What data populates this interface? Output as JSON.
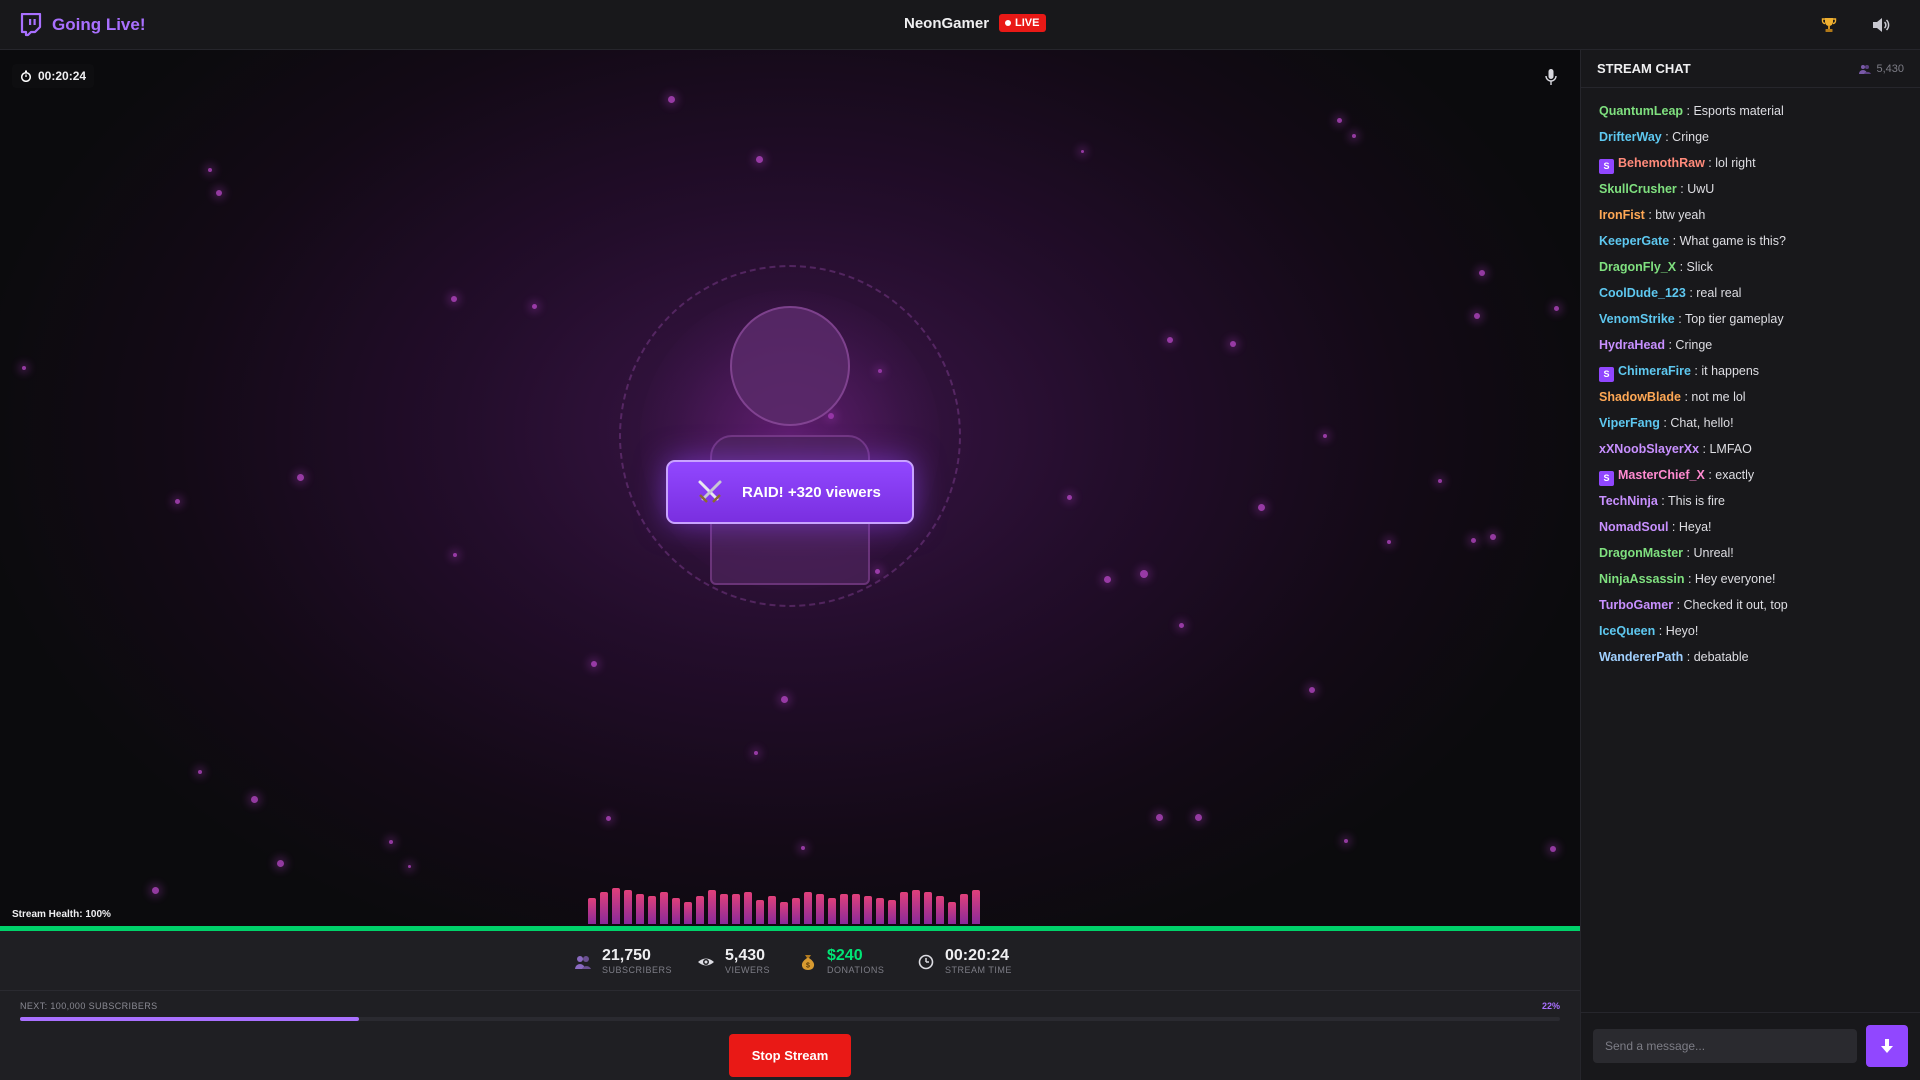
{
  "app": {
    "title": "Going Live!",
    "streamer": "NeonGamer",
    "live_label": "LIVE"
  },
  "colors": {
    "accent": "#9147ff",
    "live": "#e91916",
    "health": "#00d26a",
    "donation": "#00e676"
  },
  "stream": {
    "timer": "00:20:24",
    "raid_text": "RAID! +320 viewers",
    "health_label": "Stream Health: 100%",
    "health_percent": 100
  },
  "stats": {
    "subscribers": {
      "value": "21,750",
      "label": "SUBSCRIBERS"
    },
    "viewers": {
      "value": "5,430",
      "label": "VIEWERS"
    },
    "donations": {
      "value": "$240",
      "label": "DONATIONS"
    },
    "stream_time": {
      "value": "00:20:24",
      "label": "STREAM TIME"
    }
  },
  "goal": {
    "label": "NEXT: 100,000 SUBSCRIBERS",
    "percent_label": "22%",
    "percent": 22
  },
  "controls": {
    "stop_label": "Stop Stream"
  },
  "icons": {
    "top_right": [
      "trophy-icon",
      "speaker-icon"
    ],
    "stream": [
      "stopwatch-icon",
      "microphone-icon",
      "crossed-swords-icon"
    ],
    "stats": [
      "people-icon",
      "eye-icon",
      "money-bag-icon",
      "clock-icon"
    ]
  },
  "chat": {
    "title": "STREAM CHAT",
    "viewer_count": "5,430",
    "input_placeholder": "Send a message...",
    "messages": [
      {
        "user": "QuantumLeap",
        "color": "#7fe07f",
        "text": "Esports material",
        "sub": false
      },
      {
        "user": "DrifterWay",
        "color": "#5ec8f0",
        "text": "Cringe",
        "sub": false
      },
      {
        "user": "BehemothRaw",
        "color": "#ff8a7a",
        "text": "lol right",
        "sub": true
      },
      {
        "user": "SkullCrusher",
        "color": "#7fe07f",
        "text": "UwU",
        "sub": false
      },
      {
        "user": "IronFist",
        "color": "#ffa855",
        "text": "btw yeah",
        "sub": false
      },
      {
        "user": "KeeperGate",
        "color": "#5ec8f0",
        "text": "What game is this?",
        "sub": false
      },
      {
        "user": "DragonFly_X",
        "color": "#7fe07f",
        "text": "Slick",
        "sub": false
      },
      {
        "user": "CoolDude_123",
        "color": "#5ec8f0",
        "text": "real real",
        "sub": false
      },
      {
        "user": "VenomStrike",
        "color": "#5ec8f0",
        "text": "Top tier gameplay",
        "sub": false
      },
      {
        "user": "HydraHead",
        "color": "#c890ff",
        "text": "Cringe",
        "sub": false
      },
      {
        "user": "ChimeraFire",
        "color": "#5ec8f0",
        "text": "it happens",
        "sub": true
      },
      {
        "user": "ShadowBlade",
        "color": "#ffa855",
        "text": "not me lol",
        "sub": false
      },
      {
        "user": "ViperFang",
        "color": "#5ec8f0",
        "text": "Chat, hello!",
        "sub": false
      },
      {
        "user": "xXNoobSlayerXx",
        "color": "#c890ff",
        "text": "LMFAO",
        "sub": false
      },
      {
        "user": "MasterChief_X",
        "color": "#ff8ad0",
        "text": "exactly",
        "sub": true
      },
      {
        "user": "TechNinja",
        "color": "#c890ff",
        "text": "This is fire",
        "sub": false
      },
      {
        "user": "NomadSoul",
        "color": "#c890ff",
        "text": "Heya!",
        "sub": false
      },
      {
        "user": "DragonMaster",
        "color": "#7fe07f",
        "text": "Unreal!",
        "sub": false
      },
      {
        "user": "NinjaAssassin",
        "color": "#7fe07f",
        "text": "Hey everyone!",
        "sub": false
      },
      {
        "user": "TurboGamer",
        "color": "#c890ff",
        "text": "Checked it out, top",
        "sub": false
      },
      {
        "user": "IceQueen",
        "color": "#5ec8f0",
        "text": "Heyo!",
        "sub": false
      },
      {
        "user": "WandererPath",
        "color": "#a0d0ff",
        "text": "debatable",
        "sub": false
      }
    ]
  }
}
